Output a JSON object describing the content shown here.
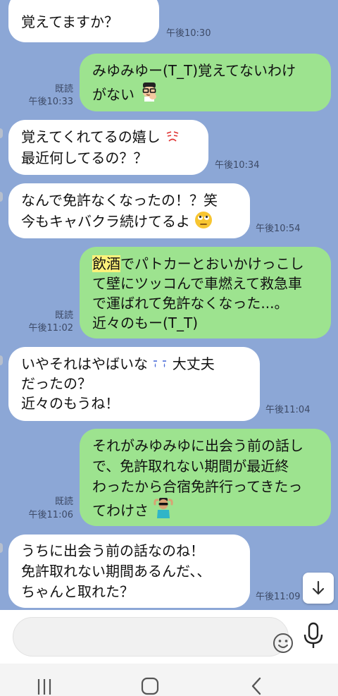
{
  "colors": {
    "background": "#8ca7d6",
    "incoming_bubble": "#ffffff",
    "outgoing_bubble": "#9de38f",
    "highlight": "#fff27a"
  },
  "messages": [
    {
      "side": "in",
      "lines": [
        "覚えてますか？"
      ],
      "time": "午後10:30"
    },
    {
      "side": "out",
      "lines": [
        "みゆみゆー(T_T)覚えてないわけ",
        "がない"
      ],
      "read": "既読",
      "time": "午後10:33",
      "emoji": "man-with-glasses-icon"
    },
    {
      "side": "in",
      "lines": [
        "覚えてくれてるの嬉し",
        "最近何してるの？？"
      ],
      "time": "午後10:34",
      "emoji": "sad-face-icon"
    },
    {
      "side": "in",
      "lines": [
        "なんで免許なくなったの！？笑",
        "今もキャバクラ続けてるよ"
      ],
      "time": "午後10:54",
      "emoji": "eye-roll-emoji-icon"
    },
    {
      "side": "out",
      "highlight": "飲酒",
      "lines": [
        "でパトカーとおいかけっこし",
        "て壁にツッコんで車燃えて救急車",
        "で運ばれて免許なくなった...。",
        "近々のもー(T_T)"
      ],
      "read": "既読",
      "time": "午後11:02"
    },
    {
      "side": "in",
      "lines": [
        "いやそれはやばいな",
        "大丈夫",
        "だったの？",
        "近々のもうね！"
      ],
      "time": "午後11:04",
      "emoji": "tear-eyes-icon"
    },
    {
      "side": "out",
      "lines": [
        "それがみゆみゆに出会う前の話し",
        "で、免許取れない期間が最近終",
        "わったから合宿免許行ってきたっ",
        "てわけさ"
      ],
      "read": "既読",
      "time": "午後11:06",
      "emoji": "sunglasses-man-icon"
    },
    {
      "side": "in",
      "lines": [
        "うちに出会う前の話なのね！",
        "免許取れない期間あるんだ、、",
        "ちゃんと取れた？"
      ],
      "time": "午後11:09"
    }
  ],
  "input": {
    "value": "",
    "placeholder": ""
  }
}
